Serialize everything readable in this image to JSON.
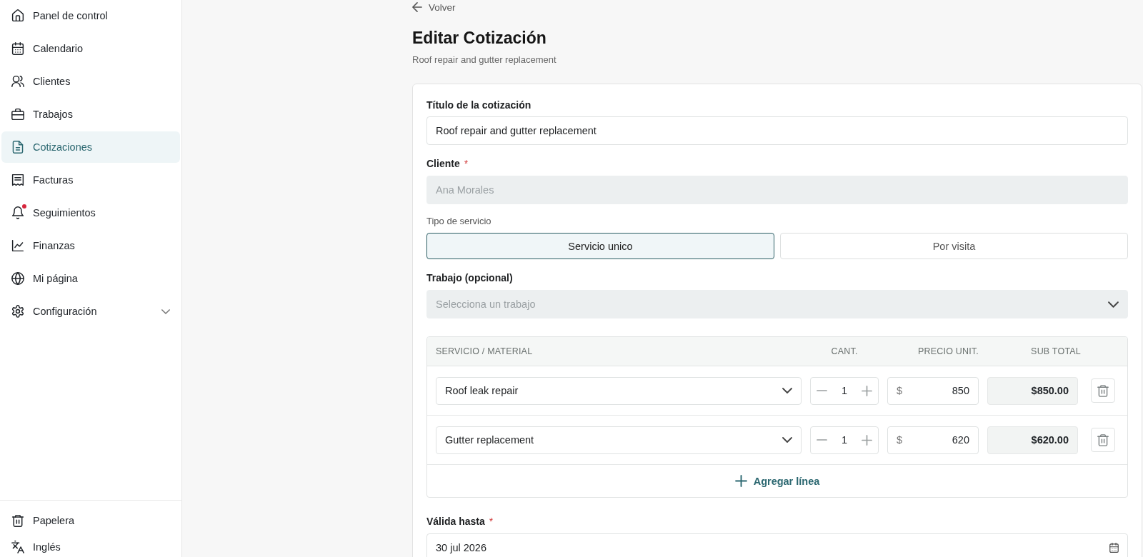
{
  "sidebar": {
    "items": [
      {
        "label": "Panel de control",
        "kind": "link",
        "selected": false,
        "alert": false
      },
      {
        "label": "Calendario",
        "kind": "link",
        "selected": false,
        "alert": false
      },
      {
        "label": "Clientes",
        "kind": "link",
        "selected": false,
        "alert": false
      },
      {
        "label": "Trabajos",
        "kind": "link",
        "selected": false,
        "alert": false
      },
      {
        "label": "Cotizaciones",
        "kind": "link",
        "selected": true,
        "alert": false
      },
      {
        "label": "Facturas",
        "kind": "link",
        "selected": false,
        "alert": false
      },
      {
        "label": "Seguimientos",
        "kind": "link",
        "selected": false,
        "alert": true
      },
      {
        "label": "Finanzas",
        "kind": "link",
        "selected": false,
        "alert": false
      },
      {
        "label": "Mi página",
        "kind": "link",
        "selected": false,
        "alert": false
      },
      {
        "label": "Configuración",
        "kind": "group",
        "selected": false,
        "alert": false,
        "expanded": false
      }
    ],
    "footer_items": [
      {
        "label": "Papelera",
        "selected": false
      },
      {
        "label": "Inglés",
        "selected": false
      }
    ]
  },
  "header": {
    "back_link": "Volver",
    "title": "Editar Cotización",
    "subtitle": "Roof repair and gutter replacement"
  },
  "form": {
    "title_field": {
      "label": "Título de la cotización",
      "value": "Roof repair and gutter replacement"
    },
    "client_field": {
      "label": "Cliente",
      "required_mark": "*",
      "value": "Ana Morales",
      "disabled": true
    },
    "service_type": {
      "label": "Tipo de servicio",
      "options": [
        {
          "label": "Servicio unico",
          "selected": true
        },
        {
          "label": "Por visita",
          "selected": false
        }
      ]
    },
    "job_field": {
      "label": "Trabajo (opcional)",
      "placeholder": "Selecciona un trabajo",
      "disabled": true
    },
    "line_items": {
      "columns": [
        "SERVICIO / MATERIAL",
        "CANT.",
        "PRECIO UNIT.",
        "SUB TOTAL"
      ],
      "rows": [
        {
          "service": "Roof leak repair",
          "quantity": "1",
          "currency": "$",
          "unit_price": "850",
          "subtotal": "$850.00"
        },
        {
          "service": "Gutter replacement",
          "quantity": "1",
          "currency": "$",
          "unit_price": "620",
          "subtotal": "$620.00"
        }
      ],
      "add_button": "Agregar línea"
    },
    "valid_until": {
      "label": "Válida hasta",
      "required_mark": "*",
      "value": "30 jul 2026"
    }
  }
}
